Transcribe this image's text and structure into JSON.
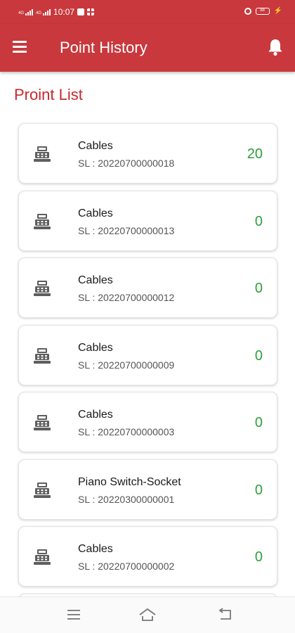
{
  "status_bar": {
    "time": "10:07",
    "battery": "88"
  },
  "app_bar": {
    "title": "Point History"
  },
  "section": {
    "title": "Proint List"
  },
  "items": [
    {
      "name": "Cables",
      "serial": "SL : 20220700000018",
      "points": "20"
    },
    {
      "name": "Cables",
      "serial": "SL : 20220700000013",
      "points": "0"
    },
    {
      "name": "Cables",
      "serial": "SL : 20220700000012",
      "points": "0"
    },
    {
      "name": "Cables",
      "serial": "SL : 20220700000009",
      "points": "0"
    },
    {
      "name": "Cables",
      "serial": "SL : 20220700000003",
      "points": "0"
    },
    {
      "name": "Piano Switch-Socket",
      "serial": "SL : 20220300000001",
      "points": "0"
    },
    {
      "name": "Cables",
      "serial": "SL : 20220700000002",
      "points": "0"
    }
  ],
  "icons": {
    "menu": "hamburger-menu-icon",
    "notifications": "bell-icon",
    "item": "cash-register-icon",
    "nav_menu": "recent-apps-icon",
    "nav_home": "home-icon",
    "nav_back": "back-icon"
  },
  "colors": {
    "primary": "#c8383c",
    "section_title": "#c8282c",
    "points": "#2ea03a"
  }
}
